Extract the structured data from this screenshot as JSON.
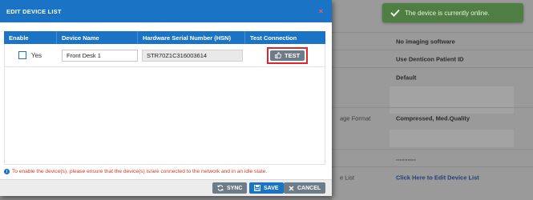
{
  "modal": {
    "title": "EDIT DEVICE LIST",
    "close_label": "×",
    "columns": [
      "Enable",
      "Device Name",
      "Hardware Serial Number (HSN)",
      "Test Connection"
    ],
    "rows": [
      {
        "enabled": false,
        "enable_label": "Yes",
        "device_name": "Front Desk 1",
        "hsn": "STR70Z1C316003614",
        "test_label": "TEST"
      }
    ],
    "notice": "To enable the device(s), please ensure that the device(s) is/are connected to the network and in an idle state.",
    "buttons": {
      "sync": "SYNC",
      "save": "SAVE",
      "cancel": "CANCEL"
    }
  },
  "toast": {
    "message": "The device is currently online."
  },
  "background": {
    "rows": [
      {
        "label": "",
        "value": "No imaging software"
      },
      {
        "label": "",
        "value": "Use Denticon Patient ID"
      },
      {
        "label": "",
        "value": "Default"
      },
      {
        "label": "age Format",
        "value": "Compressed, Med.Quality"
      },
      {
        "label": "",
        "value": "............"
      },
      {
        "label": "e List",
        "value": "Click Here to Edit Device List"
      }
    ]
  },
  "colors": {
    "primary": "#1a73c4",
    "danger": "#e3242b",
    "success": "#4f7e43",
    "neutral_button": "#6e7c89"
  }
}
